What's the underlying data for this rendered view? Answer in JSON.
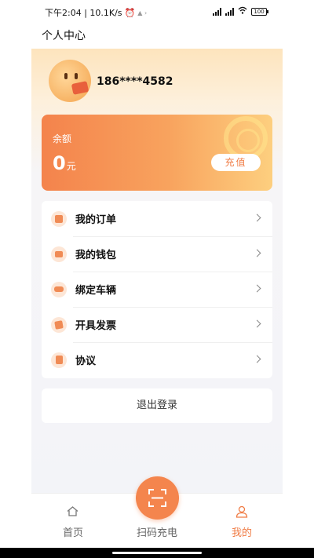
{
  "status_bar": {
    "time_speed": "下午2:04 | 10.1K/s",
    "battery": "100"
  },
  "header": {
    "title": "个人中心"
  },
  "profile": {
    "phone": "186****4582"
  },
  "balance": {
    "label": "余额",
    "amount": "0",
    "unit": "元",
    "recharge_label": "充值"
  },
  "menu": {
    "items": [
      {
        "label": "我的订单",
        "icon": "order-icon"
      },
      {
        "label": "我的钱包",
        "icon": "wallet-icon"
      },
      {
        "label": "绑定车辆",
        "icon": "car-icon"
      },
      {
        "label": "开具发票",
        "icon": "invoice-icon"
      },
      {
        "label": "协议",
        "icon": "agreement-icon"
      }
    ]
  },
  "logout_label": "退出登录",
  "bottom_nav": {
    "home": "首页",
    "scan": "扫码充电",
    "mine": "我的"
  },
  "colors": {
    "accent": "#f4854d",
    "card_start": "#f4834c",
    "card_end": "#fdcf7f"
  }
}
